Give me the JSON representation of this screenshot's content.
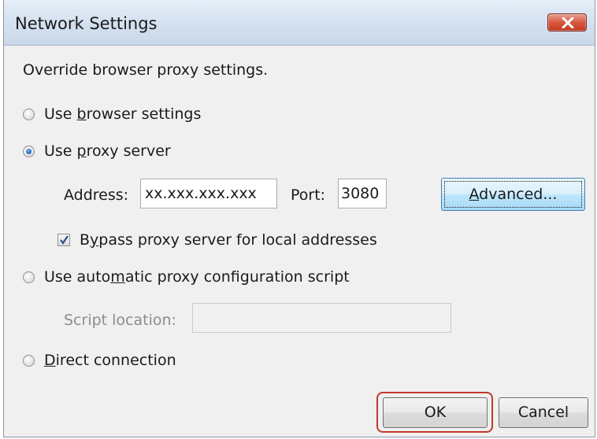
{
  "window": {
    "title": "Network Settings",
    "description": "Override browser proxy settings."
  },
  "options": {
    "browser_settings": {
      "pre": "Use ",
      "accel": "b",
      "post": "rowser settings",
      "checked": false
    },
    "proxy_server": {
      "pre": "Use ",
      "accel": "p",
      "post": "roxy server",
      "checked": true
    },
    "auto_config": {
      "pre": "Use auto",
      "accel": "m",
      "post": "atic proxy configuration script",
      "checked": false
    },
    "direct": {
      "pre": "",
      "accel": "D",
      "post": "irect connection",
      "checked": false
    }
  },
  "proxy": {
    "address_label": "Address:",
    "address_value": "xx.xxx.xxx.xxx",
    "port_label": "Port:",
    "port_value": "3080",
    "advanced_pre": "",
    "advanced_accel": "A",
    "advanced_post": "dvanced...",
    "bypass_pre": "B",
    "bypass_accel": "y",
    "bypass_post": "pass proxy server for local addresses",
    "bypass_checked": true
  },
  "script": {
    "location_label": "Script location:",
    "location_value": ""
  },
  "buttons": {
    "ok": "OK",
    "cancel": "Cancel"
  },
  "colors": {
    "highlight": "#c0392b",
    "close_button": "#c2391f"
  }
}
